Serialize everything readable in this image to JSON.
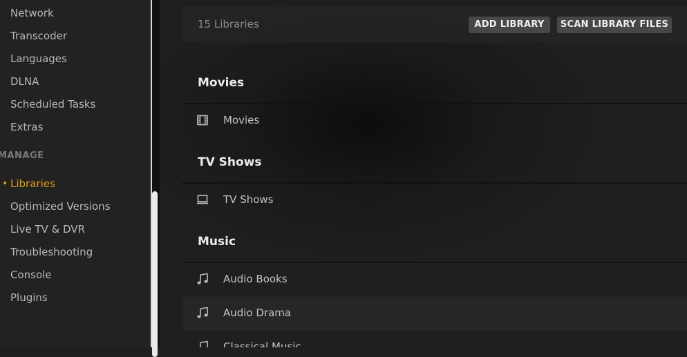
{
  "sidebar": {
    "items_top": [
      {
        "label": "Network"
      },
      {
        "label": "Transcoder"
      },
      {
        "label": "Languages"
      },
      {
        "label": "DLNA"
      },
      {
        "label": "Scheduled Tasks"
      },
      {
        "label": "Extras"
      }
    ],
    "manage_heading": "MANAGE",
    "items_manage": [
      {
        "label": "Libraries",
        "active": true
      },
      {
        "label": "Optimized Versions"
      },
      {
        "label": "Live TV & DVR"
      },
      {
        "label": "Troubleshooting"
      },
      {
        "label": "Console"
      },
      {
        "label": "Plugins"
      }
    ],
    "active_bullet": "•"
  },
  "toolbar": {
    "library_count": "15 Libraries",
    "add_library_label": "ADD LIBRARY",
    "scan_library_label": "SCAN LIBRARY FILES"
  },
  "groups": [
    {
      "title": "Movies",
      "libraries": [
        {
          "name": "Movies",
          "icon": "film-icon"
        }
      ]
    },
    {
      "title": "TV Shows",
      "libraries": [
        {
          "name": "TV Shows",
          "icon": "tv-icon"
        }
      ]
    },
    {
      "title": "Music",
      "libraries": [
        {
          "name": "Audio Books",
          "icon": "music-note-icon"
        },
        {
          "name": "Audio Drama",
          "icon": "music-note-icon"
        },
        {
          "name": "Classical Music",
          "icon": "music-note-icon"
        }
      ]
    }
  ],
  "colors": {
    "accent": "#e5a00d",
    "sidebar_bg": "#222222",
    "main_bg": "#1f1f1f",
    "button_bg": "#474747"
  }
}
